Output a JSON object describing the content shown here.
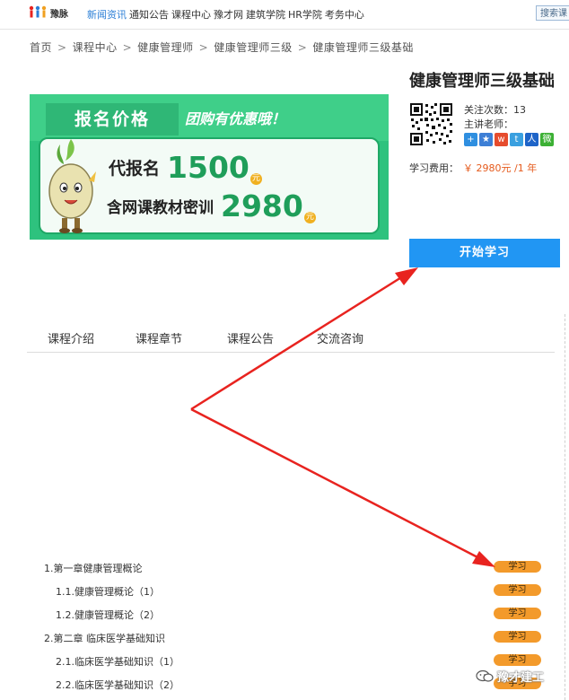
{
  "header": {
    "logo_text": "豫脉",
    "nav": [
      {
        "label": "新闻资讯",
        "active": true
      },
      {
        "label": "通知公告",
        "active": false
      },
      {
        "label": "课程中心",
        "active": false
      },
      {
        "label": "豫才网",
        "active": false
      },
      {
        "label": "建筑学院",
        "active": false
      },
      {
        "label": "HR学院",
        "active": false
      },
      {
        "label": "考务中心",
        "active": false
      }
    ],
    "search_label": "搜索课"
  },
  "breadcrumb": [
    "首页",
    "课程中心",
    "健康管理师",
    "健康管理师三级",
    "健康管理师三级基础"
  ],
  "banner": {
    "title": "报名价格",
    "slogan": "团购有优惠哦！",
    "row1_label": "代报名",
    "row1_price": "1500",
    "row2_label": "含网课教材密训",
    "row2_price": "2980",
    "yuan": "元"
  },
  "course": {
    "title": "健康管理师三级基础",
    "follow_label": "关注次数：",
    "follow_count": "13",
    "teacher_label": "主讲老师：",
    "fee_label": "学习费用：",
    "fee_value": "￥ 2980元 /1 年",
    "start_button": "开始学习"
  },
  "share_icons": [
    {
      "name": "share-more-icon",
      "color": "#2f8fe0",
      "glyph": "+"
    },
    {
      "name": "qzone-icon",
      "color": "#3d7fd6",
      "glyph": "★"
    },
    {
      "name": "weibo-icon",
      "color": "#e64c2e",
      "glyph": "w"
    },
    {
      "name": "tencent-weibo-icon",
      "color": "#3aa0e0",
      "glyph": "t"
    },
    {
      "name": "renren-icon",
      "color": "#1e64c8",
      "glyph": "人"
    },
    {
      "name": "wechat-icon",
      "color": "#3cb034",
      "glyph": "微"
    }
  ],
  "tabs": [
    "课程介绍",
    "课程章节",
    "课程公告",
    "交流咨询"
  ],
  "chapters": [
    {
      "label": "1.第一章健康管理概论",
      "button": "学习"
    },
    {
      "label": "1.1.健康管理概论（1）",
      "button": "学习"
    },
    {
      "label": "1.2.健康管理概论（2）",
      "button": "学习"
    },
    {
      "label": "2.第二章 临床医学基础知识",
      "button": "学习"
    },
    {
      "label": "2.1.临床医学基础知识（1）",
      "button": "学习"
    },
    {
      "label": "2.2.临床医学基础知识（2）",
      "button": "学习"
    }
  ],
  "watermark": "豫才建工",
  "colors": {
    "accent_blue": "#2196f3",
    "nav_active": "#2a7ed6",
    "price_orange": "#e55a1c",
    "learn_button": "#f39a2b",
    "arrow_red": "#e8231f",
    "banner_green": "#2ec27e"
  }
}
